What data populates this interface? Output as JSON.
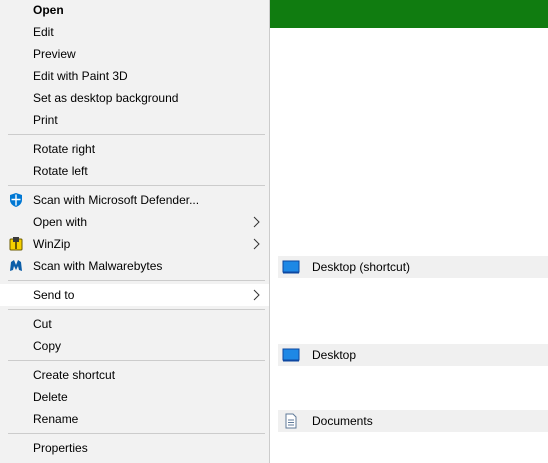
{
  "colors": {
    "header_green": "#107c10",
    "menu_bg": "#f2f2f2",
    "highlight": "#ffffff",
    "separator": "#cccccc",
    "sub_hover": "#f0f0f0"
  },
  "context_menu": {
    "items": [
      {
        "label": "Open",
        "bold": true
      },
      {
        "label": "Edit"
      },
      {
        "label": "Preview"
      },
      {
        "label": "Edit with Paint 3D"
      },
      {
        "label": "Set as desktop background"
      },
      {
        "label": "Print"
      },
      {
        "label": "Rotate right"
      },
      {
        "label": "Rotate left"
      },
      {
        "label": "Scan with Microsoft Defender...",
        "icon": "defender-shield-icon"
      },
      {
        "label": "Open with",
        "submenu": true
      },
      {
        "label": "WinZip",
        "icon": "winzip-icon",
        "submenu": true
      },
      {
        "label": "Scan with Malwarebytes",
        "icon": "malwarebytes-icon"
      },
      {
        "label": "Send to",
        "submenu": true,
        "highlighted": true
      },
      {
        "label": "Cut"
      },
      {
        "label": "Copy"
      },
      {
        "label": "Create shortcut"
      },
      {
        "label": "Delete"
      },
      {
        "label": "Rename"
      },
      {
        "label": "Properties"
      }
    ]
  },
  "send_to_submenu": {
    "items": [
      {
        "label": "Desktop (shortcut)",
        "icon": "desktop-icon"
      },
      {
        "label": "Desktop",
        "icon": "desktop-icon"
      },
      {
        "label": "Documents",
        "icon": "documents-icon"
      }
    ]
  }
}
